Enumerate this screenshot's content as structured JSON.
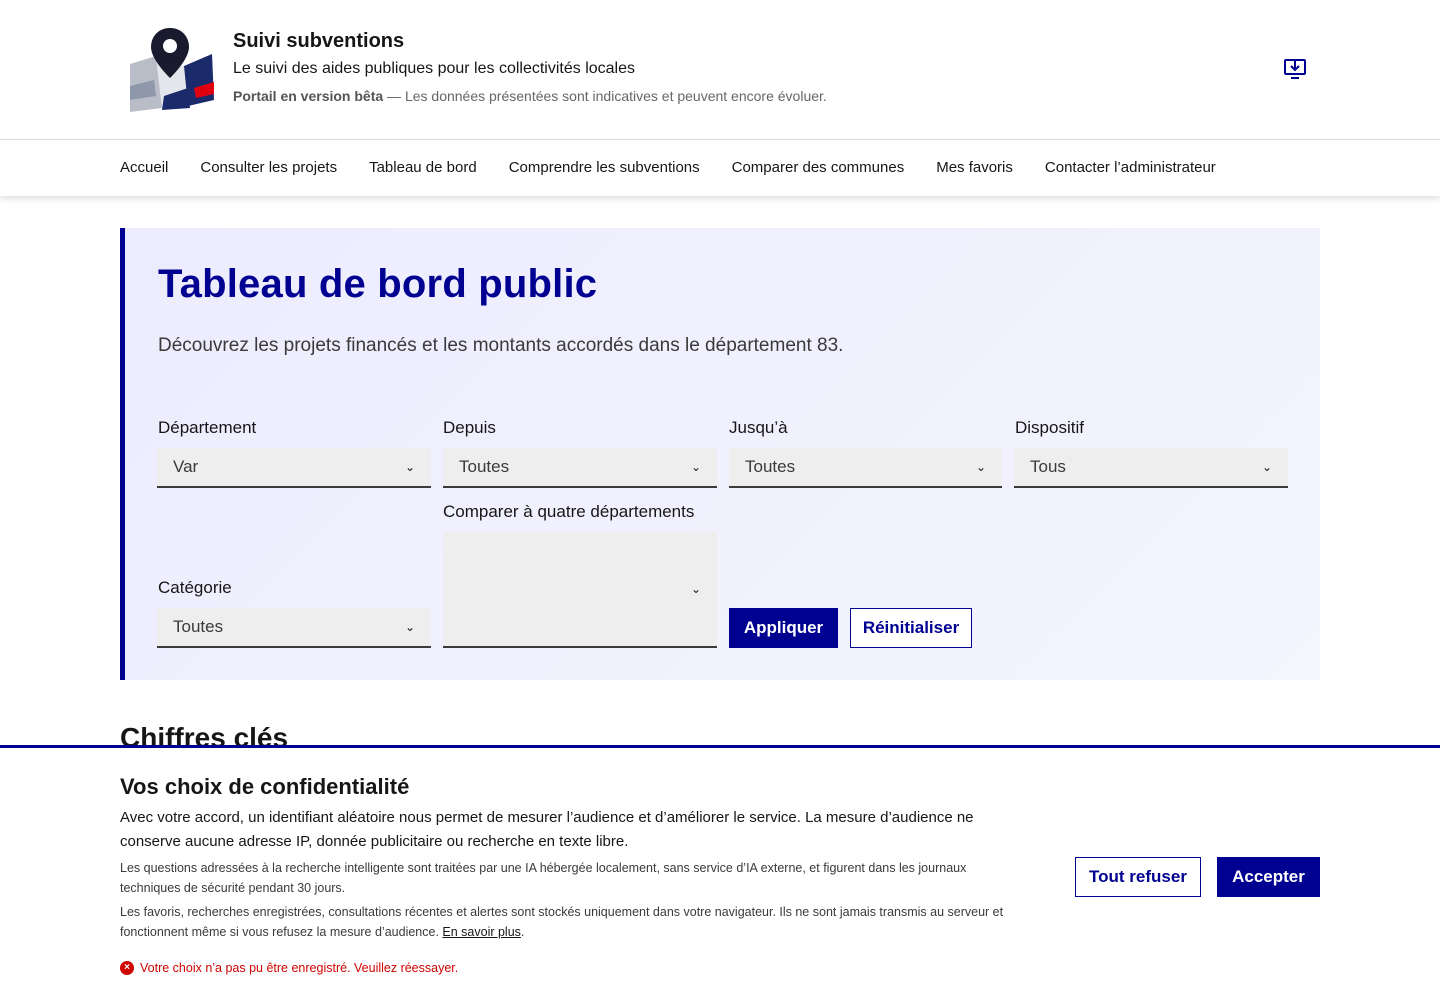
{
  "header": {
    "title": "Suivi subventions",
    "tagline": "Le suivi des aides publiques pour les collectivités locales",
    "beta_label": "Portail en version bêta",
    "beta_text": " — Les données présentées sont indicatives et peuvent encore évoluer.",
    "tool_icon": "install-app-icon"
  },
  "nav": {
    "items": [
      {
        "label": "Accueil"
      },
      {
        "label": "Consulter les projets"
      },
      {
        "label": "Tableau de bord"
      },
      {
        "label": "Comprendre les subventions"
      },
      {
        "label": "Comparer des communes"
      },
      {
        "label": "Mes favoris"
      },
      {
        "label": "Contacter l’administrateur"
      }
    ]
  },
  "hero": {
    "title": "Tableau de bord public",
    "description": "Découvrez les projets financés et les montants accordés dans le département 83."
  },
  "filters": {
    "departement": {
      "label": "Département",
      "value": "Var"
    },
    "depuis": {
      "label": "Depuis",
      "value": "Toutes"
    },
    "jusqua": {
      "label": "Jusqu’à",
      "value": "Toutes"
    },
    "dispositif": {
      "label": "Dispositif",
      "value": "Tous"
    },
    "comparer": {
      "label": "Comparer à quatre départements"
    },
    "categorie": {
      "label": "Catégorie",
      "value": "Toutes"
    },
    "apply_label": "Appliquer",
    "reset_label": "Réinitialiser"
  },
  "section": {
    "title": "Chiffres clés"
  },
  "consent": {
    "title": "Vos choix de confidentialité",
    "p1": "Avec votre accord, un identifiant aléatoire nous permet de mesurer l’audience et d’améliorer le service. La mesure d’audience ne conserve aucune adresse IP, donnée publicitaire ou recherche en texte libre.",
    "p2": "Les questions adressées à la recherche intelligente sont traitées par une IA hébergée localement, sans service d’IA externe, et figurent dans les journaux techniques de sécurité pendant 30 jours.",
    "p3": "Les favoris, recherches enregistrées, consultations récentes et alertes sont stockés uniquement dans votre navigateur. Ils ne sont jamais transmis au serveur et fonctionnent même si vous refusez la mesure d’audience. ",
    "learn_more": "En savoir plus",
    "p3_end": ".",
    "error": "Votre choix n’a pas pu être enregistré. Veuillez réessayer.",
    "refuse_label": "Tout refuser",
    "accept_label": "Accepter"
  },
  "colors": {
    "primary": "#000091",
    "error": "#ce0500",
    "hero_bg": "#ececfe"
  }
}
